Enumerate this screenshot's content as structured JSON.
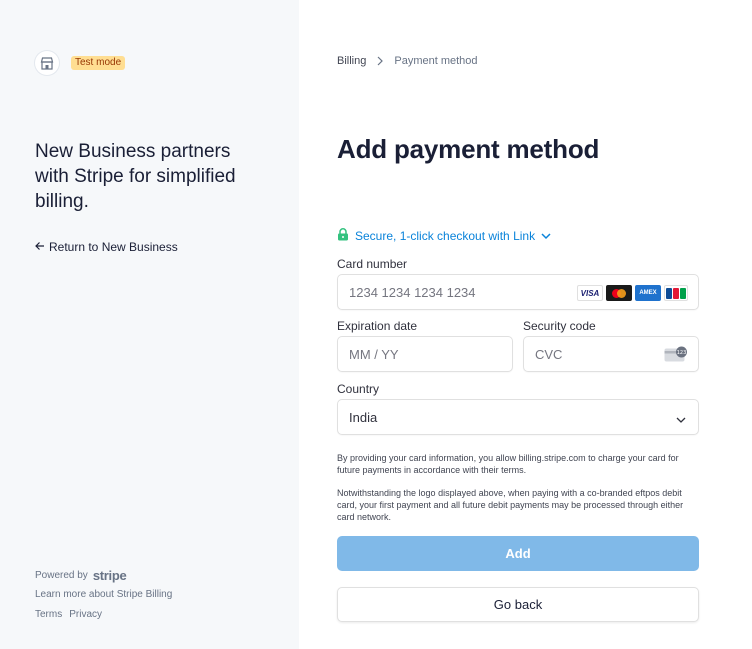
{
  "sidebar": {
    "test_badge": "Test mode",
    "headline": "New Business partners with Stripe for simplified billing.",
    "return_link": "Return to New Business",
    "powered_by": "Powered by",
    "stripe_logo": "stripe",
    "learn_more": "Learn more about Stripe Billing",
    "terms": "Terms",
    "privacy": "Privacy"
  },
  "breadcrumb": {
    "parent": "Billing",
    "current": "Payment method"
  },
  "page_title": "Add payment method",
  "link_checkout": "Secure, 1-click checkout with Link",
  "form": {
    "card_label": "Card number",
    "card_placeholder": "1234 1234 1234 1234",
    "exp_label": "Expiration date",
    "exp_placeholder": "MM / YY",
    "cvc_label": "Security code",
    "cvc_placeholder": "CVC",
    "country_label": "Country",
    "country_value": "India",
    "card_brands": [
      "VISA",
      "mastercard",
      "AMEX",
      "JCB"
    ]
  },
  "legal": {
    "p1": "By providing your card information, you allow billing.stripe.com to charge your card for future payments in accordance with their terms.",
    "p2": "Notwithstanding the logo displayed above, when paying with a co-branded eftpos debit card, your first payment and all future debit payments may be processed through either card network."
  },
  "buttons": {
    "add": "Add",
    "go_back": "Go back"
  },
  "colors": {
    "accent": "#0a83da",
    "add_button": "#80b9e8",
    "badge_bg": "#ffde92",
    "sidebar_bg": "#f6f8fa"
  }
}
